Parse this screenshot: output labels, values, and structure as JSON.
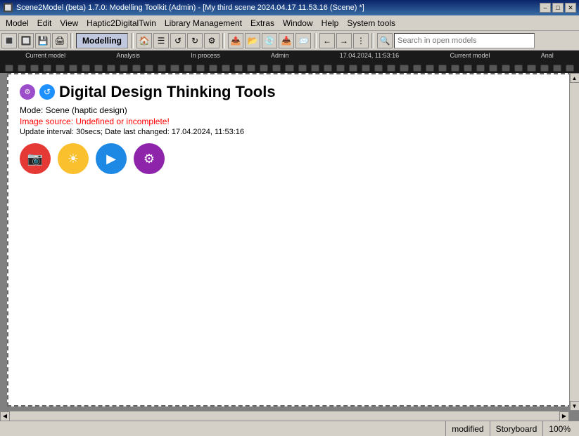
{
  "titlebar": {
    "text": "Scene2Model (beta) 1.7.0: Modelling Toolkit (Admin) - [My third scene 2024.04.17 11.53.16 (Scene) *]",
    "minimize": "–",
    "maximize": "□",
    "close": "✕"
  },
  "menubar": {
    "items": [
      "Model",
      "Edit",
      "View",
      "Haptic2DigitalTwin",
      "Library Management",
      "Extras",
      "Window",
      "Help",
      "System tools"
    ]
  },
  "toolbar": {
    "label": "Modelling",
    "search_placeholder": "Search in open models"
  },
  "filmstrip": {
    "labels": [
      "Current model",
      "Analysis",
      "In process",
      "Admin",
      "17.04.2024, 11:53:16",
      "Current model",
      "Anal"
    ]
  },
  "scene": {
    "title": "Digital Design Thinking Tools",
    "mode": "Mode: Scene (haptic design)",
    "error": "Image source: Undefined or incomplete!",
    "update": "Update interval: 30secs; Date last changed: 17.04.2024, 11:53:16",
    "buttons": {
      "camera": "📷",
      "sun": "☀",
      "play": "▶",
      "gear": "⚙"
    }
  },
  "statusbar": {
    "modified": "modified",
    "storyboard": "Storyboard",
    "zoom": "100%"
  }
}
